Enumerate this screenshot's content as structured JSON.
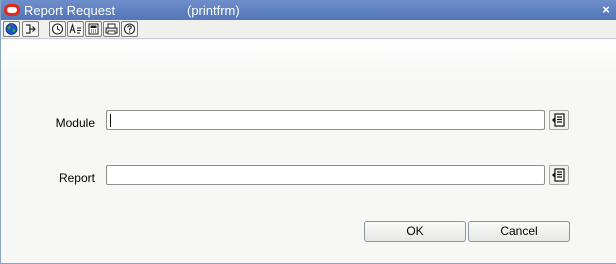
{
  "window": {
    "title": "Report Request",
    "form_name": "(printfrm)",
    "close_glyph": "×"
  },
  "toolbar": {
    "items": [
      {
        "icon": "globe-icon"
      },
      {
        "icon": "exit-icon"
      },
      {
        "icon": "clock-icon"
      },
      {
        "icon": "font-icon"
      },
      {
        "icon": "calculator-icon"
      },
      {
        "icon": "print-icon"
      },
      {
        "icon": "help-icon"
      }
    ]
  },
  "form": {
    "module_label": "Module",
    "module_value": "",
    "report_label": "Report",
    "report_value": ""
  },
  "buttons": {
    "ok_label": "OK",
    "cancel_label": "Cancel"
  },
  "colors": {
    "titlebar": "#5c7fbf",
    "oracle_red": "#e0281b"
  }
}
